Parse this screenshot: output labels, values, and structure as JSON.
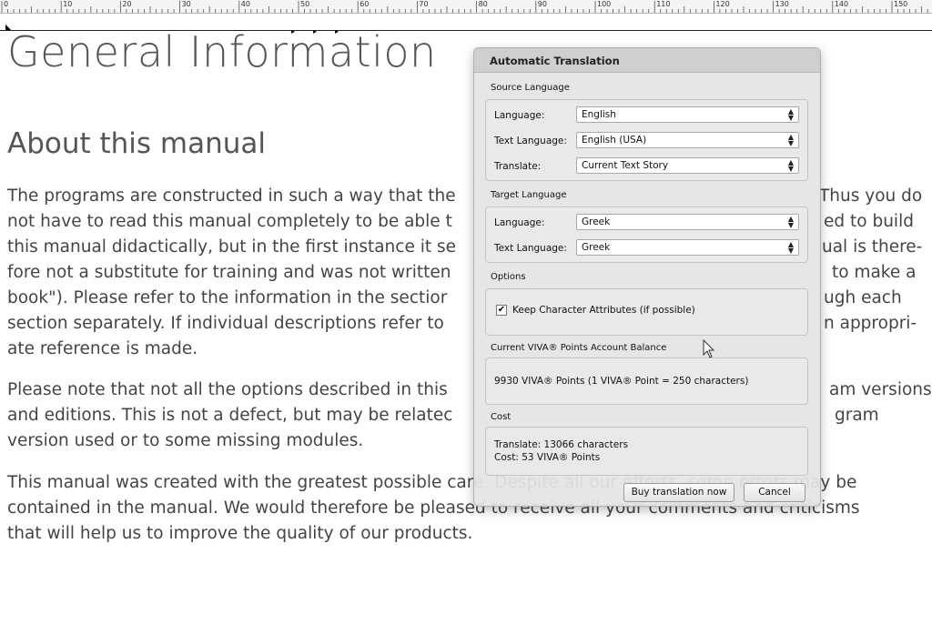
{
  "ruler": {
    "labels": [
      "0",
      "10",
      "20",
      "30",
      "40",
      "50",
      "60",
      "70",
      "80",
      "90",
      "100",
      "110",
      "120",
      "130",
      "140",
      "150"
    ]
  },
  "document": {
    "title": "General Information",
    "section_heading": "About this manual",
    "paragraph1": [
      "The programs are constructed in such a way that the",
      "not have to read this manual completely to be able t",
      "this manual didactically, but in the first instance it se",
      "fore not a substitute for training and was not written",
      "book\"). Please refer to the information in the sectior",
      "section separately. If individual descriptions refer to",
      "ate reference is made."
    ],
    "paragraph1_right": [
      "Thus you do",
      "ed to build",
      "ual is there-",
      "to make a",
      "ugh each",
      "n appropri-"
    ],
    "paragraph2": [
      "Please note that not all the options described in this",
      "and editions. This is not a defect, but may be relatec",
      "version used or to some missing modules."
    ],
    "paragraph2_right": [
      "am versions",
      "gram"
    ],
    "paragraph3": [
      "This manual was created with the greatest possible care. Despite all our efforts, some errors may be",
      "contained in the manual. We would therefore be pleased to receive all your comments and criticisms",
      "that will help us to improve the quality of our products."
    ]
  },
  "dialog": {
    "title": "Automatic Translation",
    "source_section": "Source Language",
    "source_language_label": "Language:",
    "source_language_value": "English",
    "source_text_language_label": "Text Language:",
    "source_text_language_value": "English (USA)",
    "translate_label": "Translate:",
    "translate_value": "Current Text Story",
    "target_section": "Target Language",
    "target_language_label": "Language:",
    "target_language_value": "Greek",
    "target_text_language_label": "Text Language:",
    "target_text_language_value": "Greek",
    "options_section": "Options",
    "keep_attributes_label": "Keep Character Attributes (if possible)",
    "keep_attributes_checked": true,
    "balance_section": "Current VIVA® Points Account Balance",
    "balance_text": "9930 VIVA® Points (1 VIVA® Point = 250 characters)",
    "cost_section": "Cost",
    "cost_translate": "Translate: 13066 characters",
    "cost_points": "Cost: 53 VIVA® Points",
    "buy_button": "Buy translation now",
    "cancel_button": "Cancel"
  },
  "icons": {
    "checkbox_mark": "✔",
    "select_arrow": "up-down-arrow-icon",
    "cursor": "mouse-pointer-icon"
  }
}
